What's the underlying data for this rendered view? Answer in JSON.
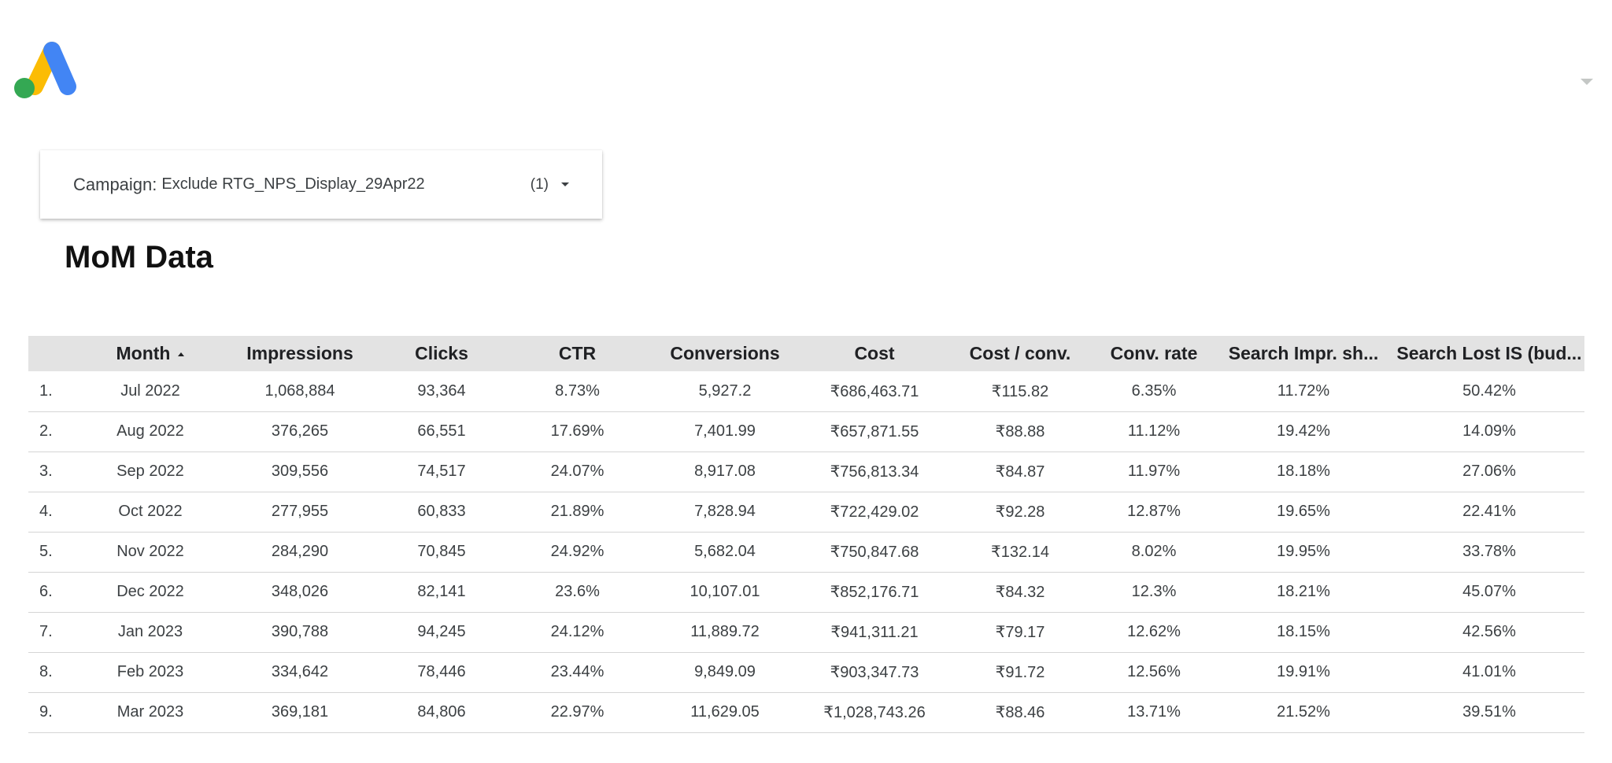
{
  "header": {
    "logo_icon": "google-ads-logo-icon",
    "menu_icon": "caret-down-icon"
  },
  "filter": {
    "label": "Campaign",
    "value": "Exclude RTG_NPS_Display_29Apr22",
    "count": "(1)",
    "icon": "caret-down-icon"
  },
  "page_title": "MoM Data",
  "table": {
    "columns": [
      "",
      "Month",
      "Impressions",
      "Clicks",
      "CTR",
      "Conversions",
      "Cost",
      "Cost / conv.",
      "Conv. rate",
      "Search Impr. sh...",
      "Search Lost IS (bud..."
    ],
    "sort_icon": "sort-ascending-icon",
    "rows": [
      [
        "1.",
        "Jul 2022",
        "1,068,884",
        "93,364",
        "8.73%",
        "5,927.2",
        "₹686,463.71",
        "₹115.82",
        "6.35%",
        "11.72%",
        "50.42%"
      ],
      [
        "2.",
        "Aug 2022",
        "376,265",
        "66,551",
        "17.69%",
        "7,401.99",
        "₹657,871.55",
        "₹88.88",
        "11.12%",
        "19.42%",
        "14.09%"
      ],
      [
        "3.",
        "Sep 2022",
        "309,556",
        "74,517",
        "24.07%",
        "8,917.08",
        "₹756,813.34",
        "₹84.87",
        "11.97%",
        "18.18%",
        "27.06%"
      ],
      [
        "4.",
        "Oct 2022",
        "277,955",
        "60,833",
        "21.89%",
        "7,828.94",
        "₹722,429.02",
        "₹92.28",
        "12.87%",
        "19.65%",
        "22.41%"
      ],
      [
        "5.",
        "Nov 2022",
        "284,290",
        "70,845",
        "24.92%",
        "5,682.04",
        "₹750,847.68",
        "₹132.14",
        "8.02%",
        "19.95%",
        "33.78%"
      ],
      [
        "6.",
        "Dec 2022",
        "348,026",
        "82,141",
        "23.6%",
        "10,107.01",
        "₹852,176.71",
        "₹84.32",
        "12.3%",
        "18.21%",
        "45.07%"
      ],
      [
        "7.",
        "Jan 2023",
        "390,788",
        "94,245",
        "24.12%",
        "11,889.72",
        "₹941,311.21",
        "₹79.17",
        "12.62%",
        "18.15%",
        "42.56%"
      ],
      [
        "8.",
        "Feb 2023",
        "334,642",
        "78,446",
        "23.44%",
        "9,849.09",
        "₹903,347.73",
        "₹91.72",
        "12.56%",
        "19.91%",
        "41.01%"
      ],
      [
        "9.",
        "Mar 2023",
        "369,181",
        "84,806",
        "22.97%",
        "11,629.05",
        "₹1,028,743.26",
        "₹88.46",
        "13.71%",
        "21.52%",
        "39.51%"
      ]
    ]
  }
}
